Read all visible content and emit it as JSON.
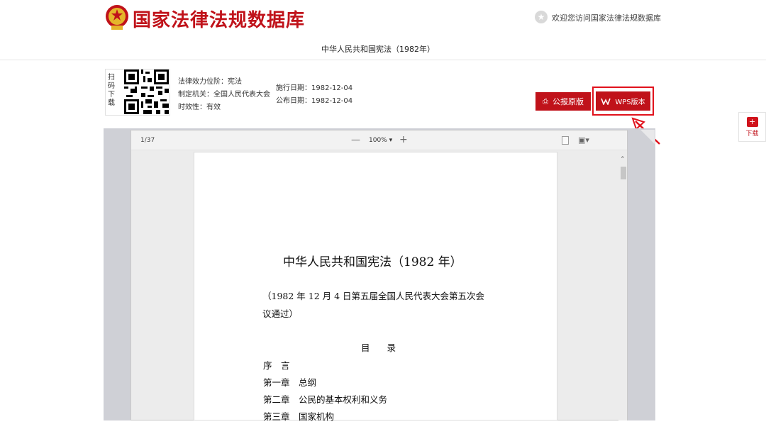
{
  "header": {
    "site_title": "国家法律法规数据库",
    "welcome": "欢迎您访问国家法律法规数据库",
    "doc_title": "中华人民共和国宪法（1982年）"
  },
  "info": {
    "qr_label": "扫码下载",
    "effect_level": "法律效力位阶：宪法",
    "authority": "制定机关：全国人民代表大会",
    "validity": "时效性：有效",
    "effective_date": "施行日期：1982-12-04",
    "publish_date": "公布日期：1982-12-04"
  },
  "buttons": {
    "gazette": "公报原版",
    "wps": "WPS版本"
  },
  "side": {
    "download": "下载"
  },
  "viewer": {
    "page_indicator": "1/37",
    "zoom_out": "—",
    "zoom_level": "100% ▾",
    "zoom_in": "+"
  },
  "document": {
    "title": "中华人民共和国宪法（1982 年）",
    "note_line1": "（1982 年 12 月 4 日第五届全国人民代表大会第五次会",
    "note_line2": "议通过）",
    "toc_heading": "目录",
    "toc": [
      "序　言",
      "第一章　总纲",
      "第二章　公民的基本权利和义务",
      "第三章　国家机构"
    ]
  },
  "colors": {
    "brand_red": "#c0121a",
    "highlight_red": "#e1121c"
  }
}
